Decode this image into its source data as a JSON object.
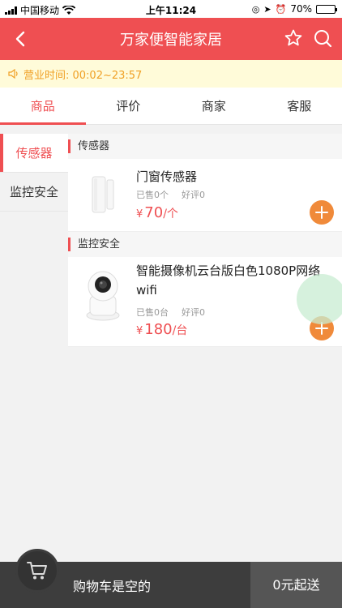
{
  "status_bar": {
    "carrier": "中国移动",
    "time": "上午11:24",
    "battery": "70%",
    "battery_level": 0.7
  },
  "nav": {
    "title": "万家便智能家居",
    "back_icon": "chevron-left-icon",
    "favorite_icon": "star-icon",
    "search_icon": "search-icon"
  },
  "hours": {
    "text": "营业时间: 00:02~23:57",
    "icon": "speaker-icon"
  },
  "tabs": [
    {
      "label": "商品"
    },
    {
      "label": "评价"
    },
    {
      "label": "商家"
    },
    {
      "label": "客服"
    }
  ],
  "categories": [
    {
      "label": "传感器"
    },
    {
      "label": "监控安全"
    }
  ],
  "sections": [
    {
      "title": "传感器",
      "product": {
        "name": "门窗传感器",
        "sold": "已售0个",
        "reviews": "好评0",
        "yen": "¥",
        "price": "70",
        "unit": "/个"
      }
    },
    {
      "title": "监控安全",
      "product": {
        "name": "智能摄像机云台版白色1080P网络wifi",
        "sold": "已售0台",
        "reviews": "好评0",
        "yen": "¥",
        "price": "180",
        "unit": "/台"
      }
    }
  ],
  "cart": {
    "empty_text": "购物车是空的",
    "checkout_label": "0元起送"
  },
  "colors": {
    "brand_red": "#ef4f52",
    "add_orange": "#f08a3a",
    "notice_bg": "#fffbd9",
    "notice_text": "#f0a025"
  }
}
